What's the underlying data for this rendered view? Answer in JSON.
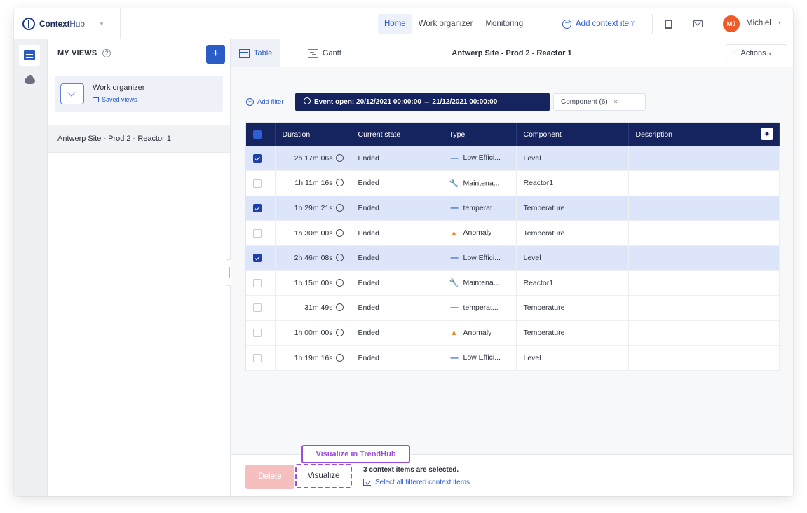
{
  "app": {
    "logo_bold": "Context",
    "logo_light": "Hub"
  },
  "nav": {
    "items": [
      "Home",
      "Work organizer",
      "Monitoring"
    ],
    "active": "Home",
    "add_context_label": "Add context item"
  },
  "user": {
    "initials": "MJ",
    "name": "Michiel"
  },
  "sidebar": {
    "heading": "MY VIEWS",
    "add_label": "+",
    "work_organizer": {
      "title": "Work organizer",
      "subtitle": "Saved views"
    },
    "items": [
      "Antwerp Site - Prod 2 - Reactor 1"
    ]
  },
  "tabs": [
    {
      "label": "Table",
      "icon": "table-icon",
      "active": true
    },
    {
      "label": "Gantt",
      "icon": "gantt-icon",
      "active": false
    }
  ],
  "view_title": "Antwerp Site - Prod 2 - Reactor 1",
  "actions_label": "Actions",
  "filters": {
    "add_label": "Add filter",
    "event_chip": "Event open: 20/12/2021 00:00:00 → 21/12/2021 00:00:00",
    "component_chip": "Component (6)"
  },
  "table": {
    "columns": [
      "Duration",
      "Current state",
      "Type",
      "Component",
      "Description"
    ],
    "rows": [
      {
        "selected": true,
        "duration": "2h 17m 06s",
        "state": "Ended",
        "type_icon": "dash-icon",
        "type": "Low Effici...",
        "component": "Level",
        "description": ""
      },
      {
        "selected": false,
        "duration": "1h 11m 16s",
        "state": "Ended",
        "type_icon": "wrench-icon",
        "type": "Maintena...",
        "component": "Reactor1",
        "description": ""
      },
      {
        "selected": true,
        "duration": "1h 29m 21s",
        "state": "Ended",
        "type_icon": "dash-icon",
        "type": "temperat...",
        "component": "Temperature",
        "description": ""
      },
      {
        "selected": false,
        "duration": "1h 30m 00s",
        "state": "Ended",
        "type_icon": "warning-icon",
        "type": "Anomaly",
        "component": "Temperature",
        "description": ""
      },
      {
        "selected": true,
        "duration": "2h 46m 08s",
        "state": "Ended",
        "type_icon": "dash-icon",
        "type": "Low Effici...",
        "component": "Level",
        "description": ""
      },
      {
        "selected": false,
        "duration": "1h 15m 00s",
        "state": "Ended",
        "type_icon": "wrench-icon",
        "type": "Maintena...",
        "component": "Reactor1",
        "description": ""
      },
      {
        "selected": false,
        "duration": "31m 49s",
        "state": "Ended",
        "type_icon": "dash-icon",
        "type": "temperat...",
        "component": "Temperature",
        "description": ""
      },
      {
        "selected": false,
        "duration": "1h 00m 00s",
        "state": "Ended",
        "type_icon": "warning-icon",
        "type": "Anomaly",
        "component": "Temperature",
        "description": ""
      },
      {
        "selected": false,
        "duration": "1h 19m 16s",
        "state": "Ended",
        "type_icon": "dash-icon",
        "type": "Low Effici...",
        "component": "Level",
        "description": ""
      }
    ]
  },
  "footer": {
    "delete_label": "Delete",
    "visualize_label": "Visualize",
    "tooltip": "Visualize in TrendHub",
    "selected_text": "3 context items are selected.",
    "select_all_label": "Select all filtered context items"
  },
  "colors": {
    "primary": "#2a5cc7",
    "header_navy": "#15235e",
    "selected_row": "#dce5fa",
    "highlight_purple": "#9a4ddb",
    "delete_disabled": "#f6bfbf",
    "avatar": "#f05a28"
  }
}
